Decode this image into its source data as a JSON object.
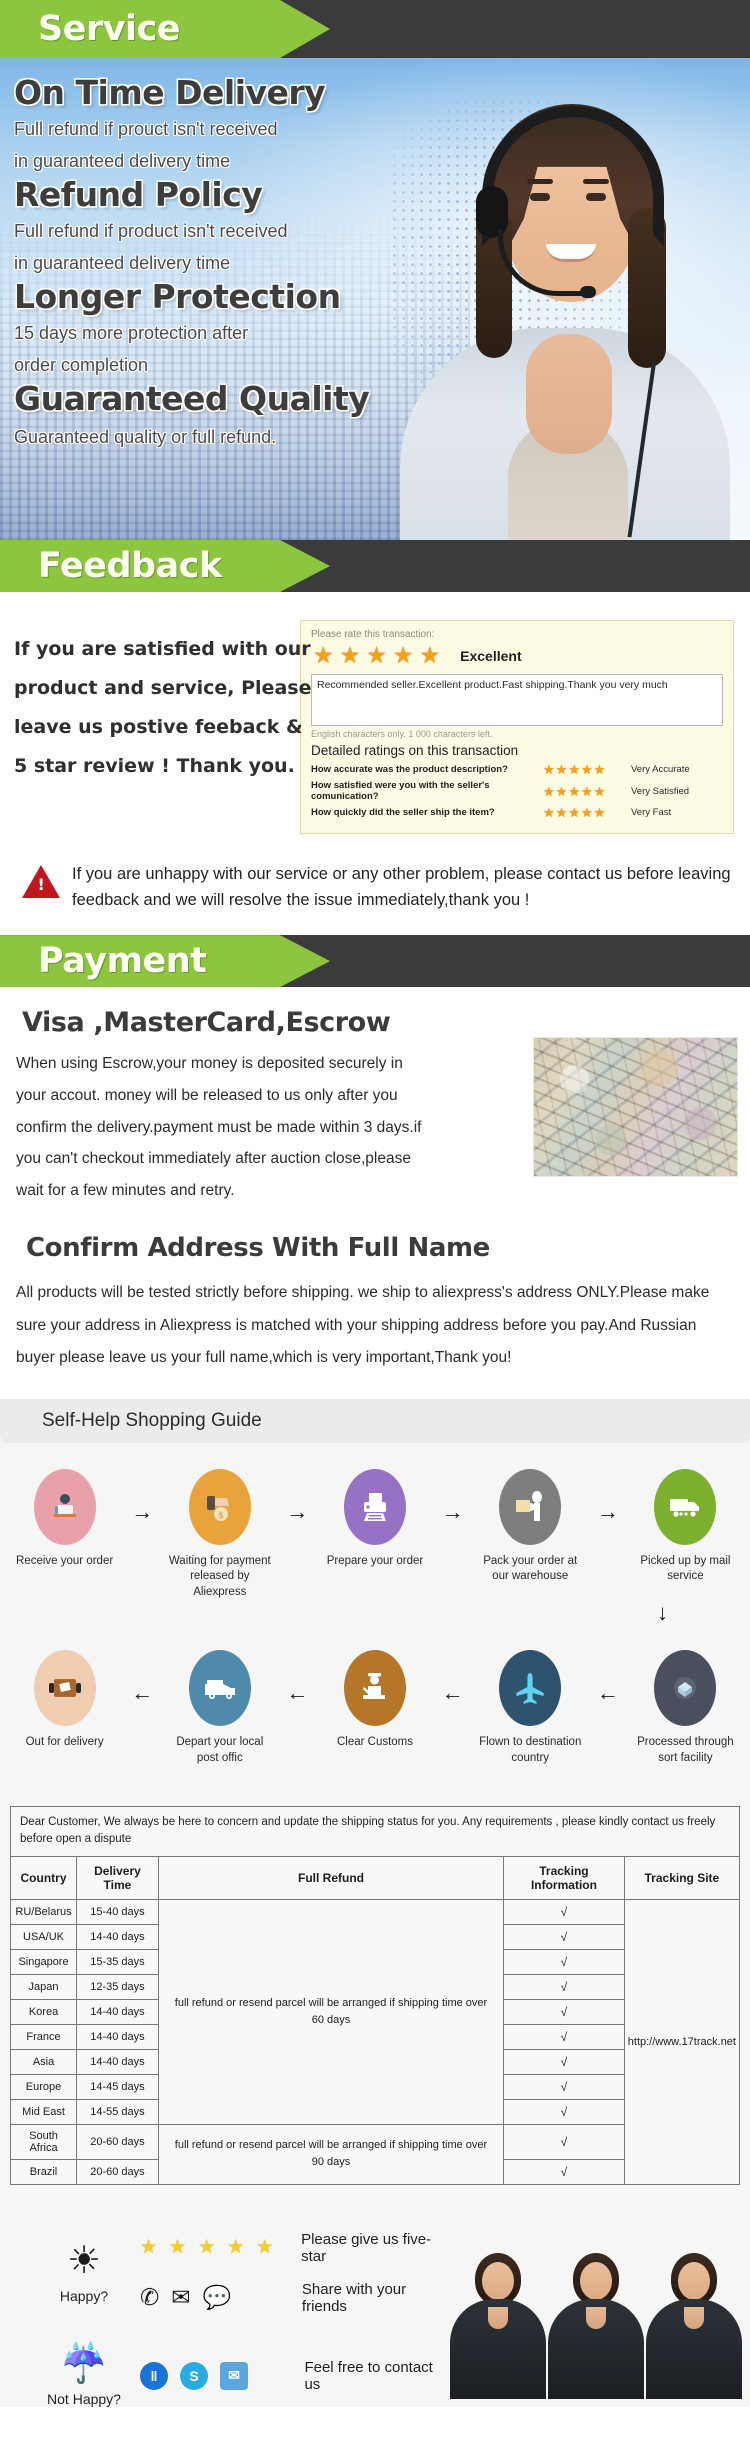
{
  "sections": {
    "service_banner": "Service",
    "feedback_banner": "Feedback",
    "payment_banner": "Payment"
  },
  "service": {
    "items": [
      {
        "title": "On Time Delivery",
        "line1": "Full refund if prouct isn't received",
        "line2": "in guaranteed delivery time"
      },
      {
        "title": "Refund Policy",
        "line1": "Full refund if product isn't received",
        "line2": "in guaranteed delivery time"
      },
      {
        "title": "Longer Protection",
        "line1": "15 days more protection after",
        "line2": "order completion"
      },
      {
        "title": "Guaranteed Quality",
        "line1": "Guaranteed quality or full refund.",
        "line2": ""
      }
    ]
  },
  "feedback": {
    "left_lines": [
      "If you are satisfied with our",
      "product and service, Please",
      "leave us postive feeback &",
      "5 star review ! Thank you."
    ],
    "rate_prompt": "Please rate this transaction:",
    "rating_word": "Excellent",
    "comment": "Recommended seller.Excellent product.Fast shipping.Thank you very much",
    "chars_hint": "English characters only. 1 000 characters left.",
    "detail_title": "Detailed ratings on this transaction",
    "detail_rows": [
      {
        "question": "How accurate was the product description?",
        "value": "Very Accurate"
      },
      {
        "question": "How satisfied were you with the seller's comunication?",
        "value": "Very Satisfied"
      },
      {
        "question": "How quickly did the seller ship the item?",
        "value": "Very Fast"
      }
    ],
    "star_glyph": "★",
    "star_count": 5,
    "warning": "If you are unhappy with our service or any other problem, please contact us before leaving feedback and we will resolve the issue immediately,thank you !",
    "warning_icon": "warning-triangle-icon"
  },
  "payment": {
    "heading": "Visa ,MasterCard,Escrow",
    "body": "When using Escrow,your money is deposited securely in your accout. money will be released to us only after you confirm the delivery.payment must be made within 3 days.if you can't checkout immediately after auction close,please wait for a few minutes and retry.",
    "address_heading": "Confirm Address With Full Name",
    "address_body": "All products will be tested strictly before shipping. we ship to aliexpress's address ONLY.Please make sure your address in Aliexpress is matched with your shipping address before you pay.And Russian buyer please leave us your full name,which is very important,Thank you!"
  },
  "guide": {
    "title": "Self-Help Shopping Guide",
    "arrow_right": "→",
    "arrow_left": "←",
    "arrow_down": "↓",
    "row1": [
      {
        "label": "Receive your order",
        "icon": "desk-worker-icon",
        "color": "#e8a0aa"
      },
      {
        "label": "Waiting for payment released by Aliexpress",
        "icon": "hand-money-icon",
        "color": "#e8a33a"
      },
      {
        "label": "Prepare your order",
        "icon": "printer-icon",
        "color": "#9771c4"
      },
      {
        "label": "Pack your order at our warehouse",
        "icon": "packing-person-icon",
        "color": "#7e7e7e"
      },
      {
        "label": "Picked up by mail service",
        "icon": "truck-icon",
        "color": "#7eb030"
      }
    ],
    "row2": [
      {
        "label": "Out for delivery",
        "icon": "package-box-icon",
        "color": "#f0cdb0"
      },
      {
        "label": "Depart your local post offic",
        "icon": "van-icon",
        "color": "#4f8aac"
      },
      {
        "label": "Clear  Customs",
        "icon": "customs-officer-icon",
        "color": "#b5762a"
      },
      {
        "label": "Flown to destination country",
        "icon": "airplane-icon",
        "color": "#2d536f"
      },
      {
        "label": "Processed through sort facility",
        "icon": "sort-facility-icon",
        "color": "#4a4f5e"
      }
    ]
  },
  "shipping": {
    "note": "Dear Customer, We always be here to concern and update the shipping status for you.  Any requirements , please kindly contact us freely before open a dispute",
    "columns": [
      "Country",
      "Delivery Time",
      "Full Refund",
      "Tracking Information",
      "Tracking Site"
    ],
    "refund_60": "full refund or resend parcel will be arranged if shipping time over 60 days",
    "refund_90": "full refund or resend parcel will be arranged if shipping time over 90 days",
    "tracking_site": "http://www.17track.net",
    "check": "√",
    "rows": [
      {
        "country": "RU/Belarus",
        "time": "15-40 days"
      },
      {
        "country": "USA/UK",
        "time": "14-40 days"
      },
      {
        "country": "Singapore",
        "time": "15-35 days"
      },
      {
        "country": "Japan",
        "time": "12-35 days"
      },
      {
        "country": "Korea",
        "time": "14-40 days"
      },
      {
        "country": "France",
        "time": "14-40 days"
      },
      {
        "country": "Asia",
        "time": "14-40 days"
      },
      {
        "country": "Europe",
        "time": "14-45 days"
      },
      {
        "country": "Mid East",
        "time": "14-55 days"
      },
      {
        "country": "South Africa",
        "time": "20-60 days"
      },
      {
        "country": "Brazil",
        "time": "20-60 days"
      }
    ]
  },
  "footer": {
    "happy_label": "Happy?",
    "happy_icon": "sun-icon",
    "not_happy_label": "Not Happy?",
    "not_happy_icon": "rain-cloud-icon",
    "star_glyph": "★",
    "star_count": 5,
    "line_five_star": "Please give us five-star",
    "line_share": "Share with your friends",
    "line_contact": "Feel free to contact us",
    "share_icons": [
      "phone-icon",
      "mail-icon",
      "chat-bubble-icon"
    ],
    "contact_icons": [
      "trademanager-icon",
      "skype-icon",
      "email-icon"
    ],
    "contact_colors": [
      "#1b72d8",
      "#2aabe2",
      "#5aa7e0"
    ]
  },
  "colors": {
    "banner_green": "#8cc63e",
    "banner_dark": "#3b3b3b",
    "star_orange": "#f5a019",
    "warning_red": "#c1171c",
    "feedback_bg": "#fdfbe4"
  }
}
